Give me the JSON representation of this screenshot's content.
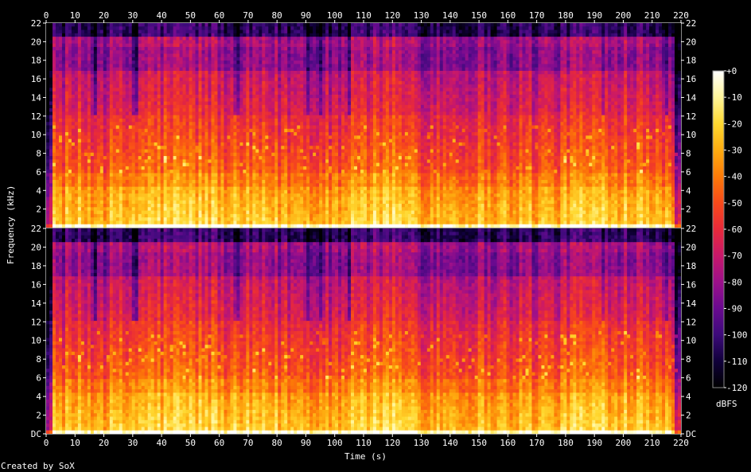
{
  "chart_data": {
    "type": "heatmap",
    "subtype": "spectrogram",
    "xlabel": "Time (s)",
    "ylabel": "Frequency (kHz)",
    "x_range": [
      0,
      220
    ],
    "x_ticks": [
      0,
      10,
      20,
      30,
      40,
      50,
      60,
      70,
      80,
      90,
      100,
      110,
      120,
      130,
      140,
      150,
      160,
      170,
      180,
      190,
      200,
      210,
      220
    ],
    "y_range": [
      0,
      22
    ],
    "y_tick_labels_upper": [
      "22",
      "20",
      "18",
      "16",
      "14",
      "12",
      "10",
      "8",
      "6",
      "4",
      "2"
    ],
    "y_tick_labels_lower": [
      "22",
      "20",
      "18",
      "16",
      "14",
      "12",
      "10",
      "8",
      "6",
      "4",
      "2",
      "DC"
    ],
    "y_tick_values": [
      22,
      20,
      18,
      16,
      14,
      12,
      10,
      8,
      6,
      4,
      2,
      0
    ],
    "channels": 2,
    "colorbar": {
      "label": "dBFS",
      "range": [
        -120,
        0
      ],
      "tick_labels": [
        "+0",
        "-10",
        "-20",
        "-30",
        "-40",
        "-50",
        "-60",
        "-70",
        "-80",
        "-90",
        "-100",
        "-110",
        "-120"
      ],
      "colors": [
        "#000000",
        "#10003a",
        "#3c0a7a",
        "#6a0a90",
        "#9c108a",
        "#c8186a",
        "#e82a3a",
        "#f84a1a",
        "#fc7a08",
        "#feac10",
        "#ffd830",
        "#fff59a",
        "#ffffff"
      ]
    },
    "legend": "right",
    "grid": false
  },
  "footer": {
    "credit": "Created by SoX"
  }
}
